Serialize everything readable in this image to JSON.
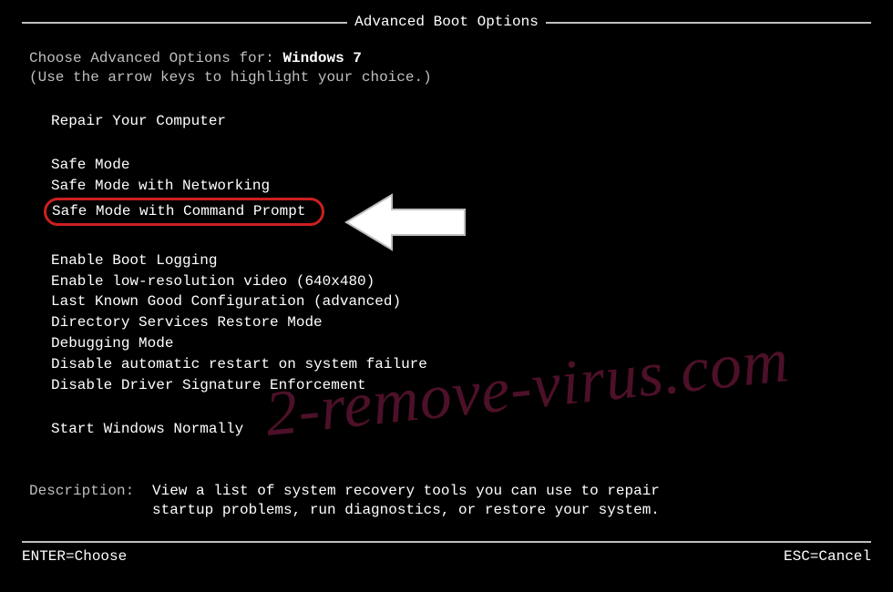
{
  "title": "Advanced Boot Options",
  "choose_prefix": "Choose Advanced Options for: ",
  "os_name": "Windows 7",
  "instruction": "(Use the arrow keys to highlight your choice.)",
  "groups": [
    {
      "items": [
        "Repair Your Computer"
      ]
    },
    {
      "items": [
        "Safe Mode",
        "Safe Mode with Networking",
        "Safe Mode with Command Prompt"
      ]
    },
    {
      "items": [
        "Enable Boot Logging",
        "Enable low-resolution video (640x480)",
        "Last Known Good Configuration (advanced)",
        "Directory Services Restore Mode",
        "Debugging Mode",
        "Disable automatic restart on system failure",
        "Disable Driver Signature Enforcement"
      ]
    },
    {
      "items": [
        "Start Windows Normally"
      ]
    }
  ],
  "selected_option": "Safe Mode with Command Prompt",
  "description_label": "Description:",
  "description": "View a list of system recovery tools you can use to repair startup problems, run diagnostics, or restore your system.",
  "footer_left": "ENTER=Choose",
  "footer_right": "ESC=Cancel",
  "watermark": "2-remove-virus.com",
  "colors": {
    "bg": "#000000",
    "text_gray": "#bfbfbf",
    "text_white": "#ffffff",
    "highlight_border": "#cc2020",
    "watermark": "rgba(140,30,75,0.55)"
  }
}
